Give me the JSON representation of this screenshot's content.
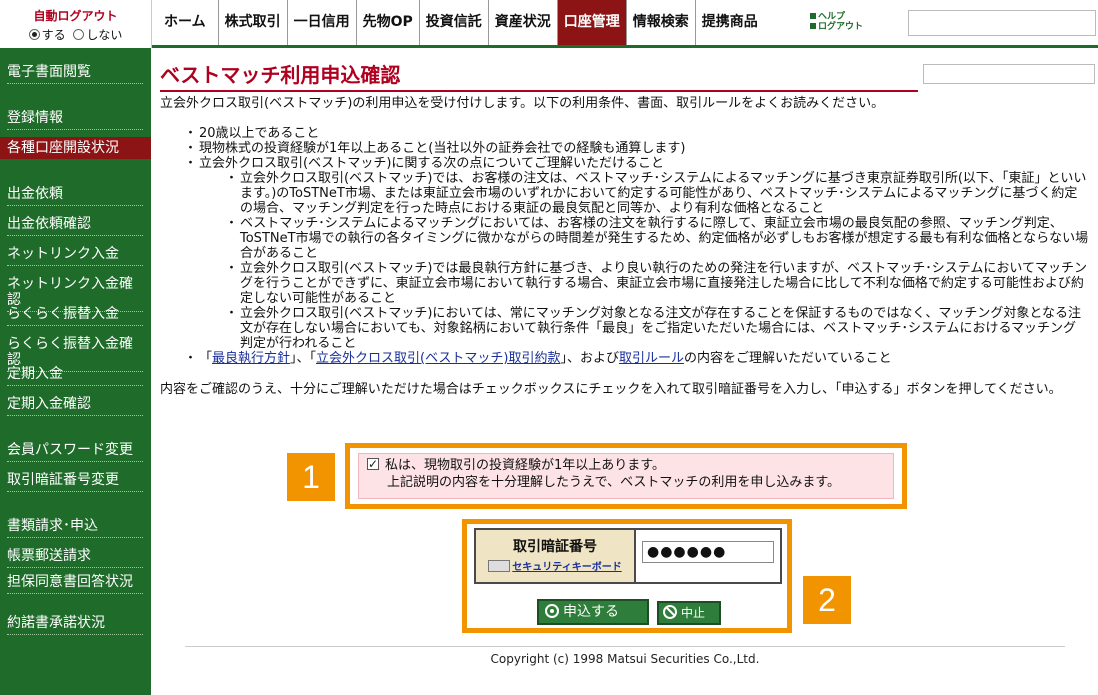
{
  "header": {
    "auto_logout_title": "自動ログアウト",
    "auto_logout_on": "する",
    "auto_logout_off": "しない",
    "help_label": "ヘルプ",
    "logout_label": "ログアウト",
    "nav": [
      {
        "label": "ホーム"
      },
      {
        "label": "株式取引"
      },
      {
        "label": "一日信用"
      },
      {
        "label": "先物OP"
      },
      {
        "label": "投資信託"
      },
      {
        "label": "資産状況"
      },
      {
        "label": "口座管理",
        "active": true
      },
      {
        "label": "情報検索"
      },
      {
        "label": "提携商品"
      }
    ]
  },
  "sidebar": {
    "items": [
      {
        "label": "電子書面閲覧"
      },
      {
        "label": "登録情報"
      },
      {
        "label": "各種口座開設状況",
        "active": true
      },
      {
        "label": "出金依頼"
      },
      {
        "label": "出金依頼確認"
      },
      {
        "label": "ネットリンク入金"
      },
      {
        "label": "ネットリンク入金確認"
      },
      {
        "label": "らくらく振替入金"
      },
      {
        "label": "らくらく振替入金確認"
      },
      {
        "label": "定期入金"
      },
      {
        "label": "定期入金確認"
      },
      {
        "label": "会員パスワード変更"
      },
      {
        "label": "取引暗証番号変更"
      },
      {
        "label": "書類請求･申込"
      },
      {
        "label": "帳票郵送請求"
      },
      {
        "label": "担保同意書回答状況"
      },
      {
        "label": "約諾書承諾状況"
      }
    ]
  },
  "main": {
    "title": "ベストマッチ利用申込確認",
    "intro": "立会外クロス取引(ベストマッチ)の利用申込を受け付けします。以下の利用条件、書面、取引ルールをよくお読みください。",
    "conditions": [
      "20歳以上であること",
      "現物株式の投資経験が1年以上あること(当社以外の証券会社での経験も通算します)",
      "立会外クロス取引(ベストマッチ)に関する次の点についてご理解いただけること"
    ],
    "sub_points": [
      "立会外クロス取引(ベストマッチ)では、お客様の注文は、ベストマッチ･システムによるマッチングに基づき東京証券取引所(以下、「東証」といいます。)のToSTNeT市場、または東証立会市場のいずれかにおいて約定する可能性があり、ベストマッチ･システムによるマッチングに基づく約定の場合、マッチング判定を行った時点における東証の最良気配と同等か、より有利な価格となること",
      "ベストマッチ･システムによるマッチングにおいては、お客様の注文を執行するに際して、東証立会市場の最良気配の参照、マッチング判定、ToSTNeT市場での執行の各タイミングに微かながらの時間差が発生するため、約定価格が必ずしもお客様が想定する最も有利な価格とならない場合があること",
      "立会外クロス取引(ベストマッチ)では最良執行方針に基づき、より良い執行のための発注を行いますが、ベストマッチ･システムにおいてマッチングを行うことができずに、東証立会市場において執行する場合、東証立会市場に直接発注した場合に比して不利な価格で約定する可能性および約定しない可能性があること",
      "立会外クロス取引(ベストマッチ)においては、常にマッチング対象となる注文が存在することを保証するものではなく、マッチング対象となる注文が存在しない場合においても、対象銘柄において執行条件「最良」をご指定いただいた場合には、ベストマッチ･システムにおけるマッチング判定が行われること"
    ],
    "docs_line": {
      "pre": "「",
      "link1": "最良執行方針",
      "mid1": "」、「",
      "link2": "立会外クロス取引(ベストマッチ)取引約款",
      "mid2": "」、および",
      "link3": "取引ルール",
      "post": "の内容をご理解いただいていること"
    },
    "instruction": "内容をご確認のうえ、十分にご理解いただけた場合はチェックボックスにチェックを入れて取引暗証番号を入力し、「申込する」ボタンを押してください。",
    "agree_line1": "私は、現物取引の投資経験が1年以上あります。",
    "agree_line2": "上記説明の内容を十分理解したうえで、ベストマッチの利用を申し込みます。",
    "badge1": "1",
    "badge2": "2",
    "pin_label": "取引暗証番号",
    "security_keyboard": "セキュリティキーボード",
    "pin_value": "●●●●●●",
    "submit_label": "申込する",
    "cancel_label": "中止"
  },
  "footer": {
    "copyright": "Copyright (c) 1998 Matsui Securities Co.,Ltd."
  }
}
